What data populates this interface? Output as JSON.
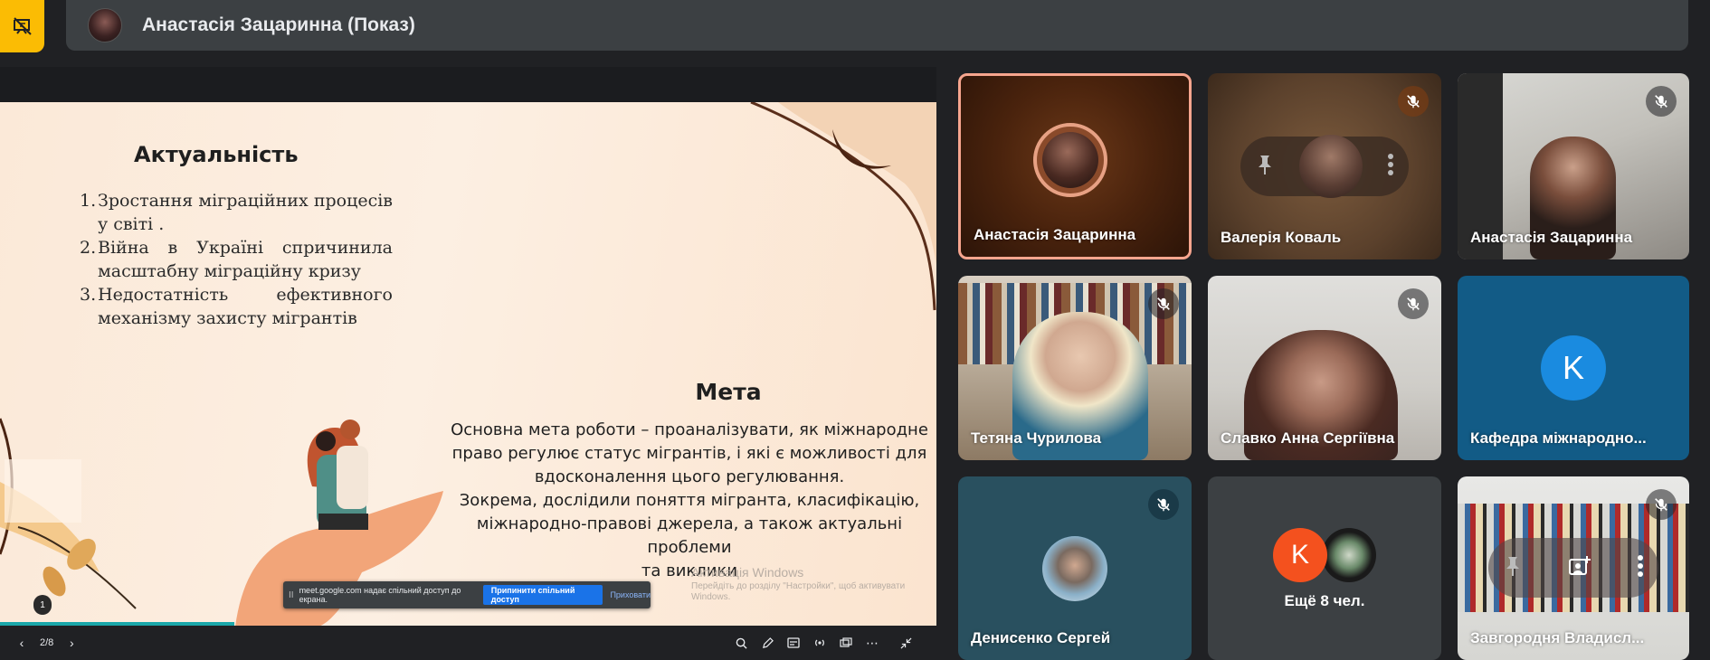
{
  "presenter": {
    "name": "Анастасія Зацаринна (Показ)",
    "status_icon": "presentation-off-icon"
  },
  "slide": {
    "title_relevance": "Актуальність",
    "list": [
      {
        "num": "1.",
        "text": "Зростання міграційних процесів у світі ."
      },
      {
        "num": "2.",
        "text": "Війна в Україні спричинила масштабну міграційну кризу"
      },
      {
        "num": "3.",
        "text": "Недостатність ефективного механізму захисту мігрантів"
      }
    ],
    "title_goal": "Мета",
    "body": [
      "Основна мета  роботи –  проаналізувати, як міжнародне",
      "право регулює статус мігрантів, і які є можливості для",
      "вдосконалення цього регулювання.",
      "Зокрема,  дослідили поняття мігранта, класифікацію,",
      "міжнародно-правові джерела, а також актуальні проблеми",
      "та виклики"
    ],
    "bubble_count": "1"
  },
  "windows_activation": {
    "title": "Активація Windows",
    "subtitle": "Перейдіть до розділу \"Настройки\", щоб активувати Windows."
  },
  "share_banner": {
    "grip": "II",
    "text": "meet.google.com надає спільний доступ до екрана.",
    "stop_label": "Припинити спільний доступ",
    "hide_label": "Приховати"
  },
  "controls": {
    "page": "2/8",
    "progress_fraction": 0.25
  },
  "tiles": [
    {
      "name": "Анастасія Зацаринна",
      "muted": false
    },
    {
      "name": "Валерія Коваль",
      "muted": true
    },
    {
      "name": "Анастасія Зацаринна",
      "muted": true
    },
    {
      "name": "Тетяна Чурилова",
      "muted": true
    },
    {
      "name": "Славко Анна Сергіївна",
      "muted": true
    },
    {
      "name": "Кафедра  міжнародно...",
      "initial": "K",
      "muted": false
    },
    {
      "name": "Денисенко Сергей",
      "muted": true
    },
    {
      "others_label": "Ещё 8 чел.",
      "initial": "K"
    },
    {
      "name": "Завгородня Владисл...",
      "muted": true
    }
  ],
  "colors": {
    "accent_yellow": "#fbbc04",
    "blue": "#1a73e8",
    "orange_avatar": "#f4511e",
    "kafedra_avatar": "#1a8be0",
    "progress": "#1aa7a9"
  }
}
